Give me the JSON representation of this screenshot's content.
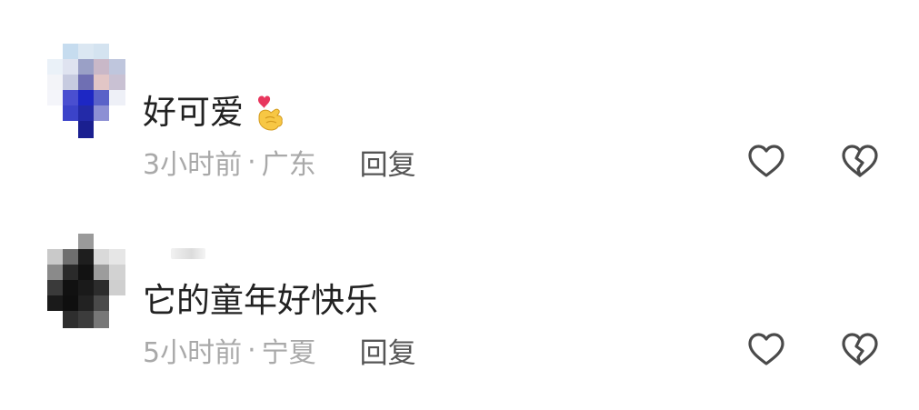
{
  "comments": [
    {
      "text": "好可爱",
      "emoji": "finger-heart-emoji",
      "time": "3小时前",
      "separator": "·",
      "location": "广东",
      "reply_label": "回复"
    },
    {
      "text": "它的童年好快乐",
      "time": "5小时前",
      "separator": "·",
      "location": "宁夏",
      "reply_label": "回复"
    }
  ],
  "icons": {
    "like": "heart-outline-icon",
    "dislike": "broken-heart-icon"
  },
  "colors": {
    "text": "#222222",
    "meta": "#a9a9a9",
    "reply": "#555555",
    "icon_stroke": "#4a4a4a"
  }
}
